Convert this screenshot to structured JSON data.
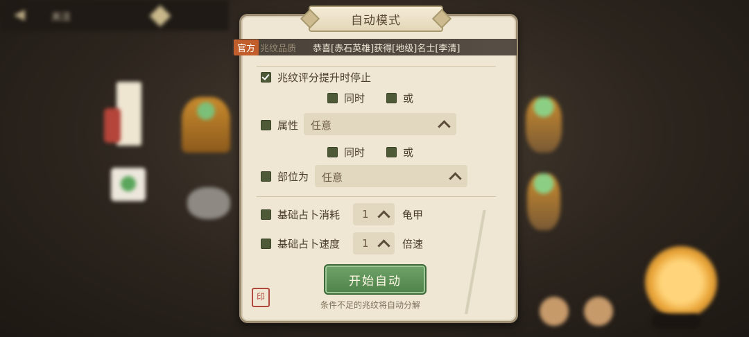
{
  "background": {
    "top_text": "关注"
  },
  "title": "自动模式",
  "ticker": {
    "tag": "官方",
    "sub": "兆纹品质",
    "message": "恭喜[赤石英雄]获得[地级]名士[李清]"
  },
  "options": {
    "stop_on_score": {
      "label": "兆纹评分提升时停止",
      "checked": true
    },
    "attr_logic": {
      "and_label": "同时",
      "or_label": "或"
    },
    "attribute": {
      "label": "属性",
      "value": "任意",
      "checked": false
    },
    "part_logic": {
      "and_label": "同时",
      "or_label": "或"
    },
    "part": {
      "label": "部位为",
      "value": "任意",
      "checked": false
    },
    "cost": {
      "label": "基础占卜消耗",
      "value": "1",
      "unit": "龟甲",
      "checked": false
    },
    "speed": {
      "label": "基础占卜速度",
      "value": "1",
      "unit": "倍速",
      "checked": false
    }
  },
  "start_button": "开始自动",
  "footnote": "条件不足的兆纹将自动分解",
  "stamp": "印",
  "colors": {
    "panel": "#efe7d3",
    "checkbox": "#4e5a37",
    "button": "#5b9155",
    "tag": "#c25e2c"
  }
}
